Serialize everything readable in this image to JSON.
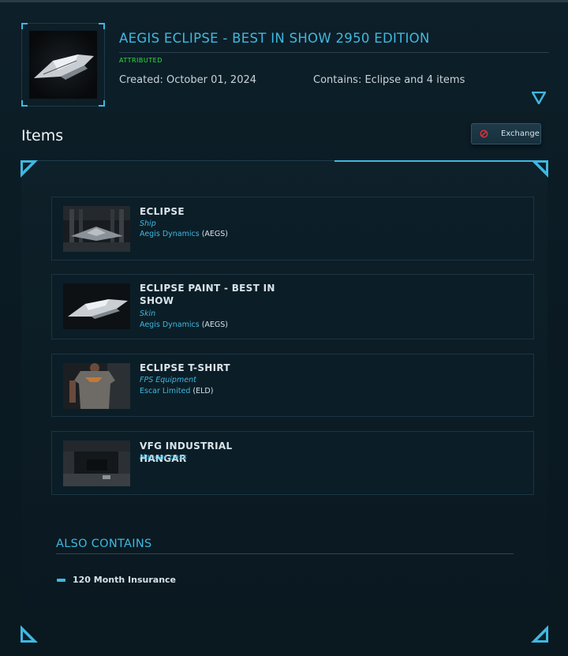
{
  "package": {
    "title": "AEGIS ECLIPSE - BEST IN SHOW 2950 EDITION",
    "status": "ATTRIBUTED",
    "created": "Created: October 01, 2024",
    "contains": "Contains: Eclipse and 4 items"
  },
  "items_section": {
    "heading": "Items",
    "exchange_label": "Exchange"
  },
  "items": [
    {
      "name": "ECLIPSE",
      "type": "Ship",
      "maker": "Aegis Dynamics",
      "maker_code": "(AEGS)",
      "image_icon": "hangar-ship-image"
    },
    {
      "name": "ECLIPSE PAINT - BEST IN SHOW",
      "type": "Skin",
      "maker": "Aegis Dynamics",
      "maker_code": "(AEGS)",
      "image_icon": "ship-paint-image"
    },
    {
      "name": "ECLIPSE T-SHIRT",
      "type": "FPS Equipment",
      "maker": "Escar Limited",
      "maker_code": "(ELD)",
      "image_icon": "tshirt-image"
    },
    {
      "name": "VFG INDUSTRIAL HANGAR",
      "type": "Hangar pass",
      "image_icon": "hangar-image"
    }
  ],
  "also_contains": {
    "heading": "ALSO CONTAINS",
    "items": [
      "120 Month Insurance"
    ]
  },
  "colors": {
    "accent": "#3fb8e0",
    "status_green": "#2ee03a",
    "background": "#0b1a22",
    "exchange_icon": "#e0303a"
  }
}
